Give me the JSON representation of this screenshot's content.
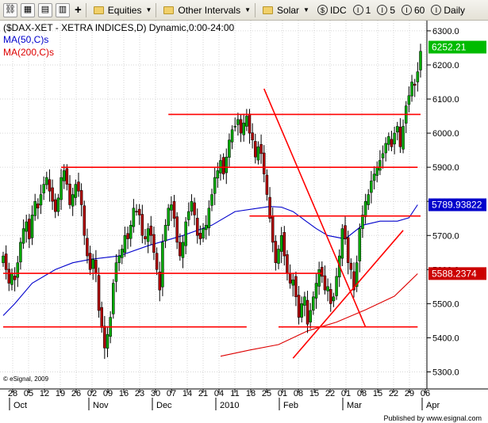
{
  "toolbar": {
    "menus": [
      "Equities",
      "Other Intervals",
      "Solar"
    ],
    "idc_label": "IDC",
    "interval_buttons": [
      {
        "icon": "I",
        "label": "1"
      },
      {
        "icon": "I",
        "label": "5"
      },
      {
        "icon": "I",
        "label": "60"
      }
    ],
    "daily_icon": "I",
    "daily_label": "Daily"
  },
  "chart_header": {
    "title": "($DAX-XET - XETRA INDICES,D) Dynamic,0:00-24:00",
    "ma50_label": "MA(50,C)s",
    "ma200_label": "MA(200,C)s"
  },
  "price_badges": {
    "last": "6252.21",
    "ma50": "5789.93822",
    "ma200": "5588.2374"
  },
  "watermark": "© eSignal, 2009",
  "footer": "Published by www.esignal.com",
  "colors": {
    "up_candle": "#00aa00",
    "down_candle": "#b00000",
    "ma50": "#0000cc",
    "ma200": "#dd0000",
    "trendlines": "#ff0000",
    "last_badge": "#00bb00",
    "ma50_badge": "#0000cc",
    "ma200_badge": "#cc0000"
  },
  "chart_data": {
    "type": "candlestick",
    "title": "($DAX-XET - XETRA INDICES,D) Dynamic,0:00-24:00",
    "y_axis_side": "right",
    "ylim": [
      5250,
      6330
    ],
    "y_ticks": [
      5300,
      5400,
      5500,
      5600,
      5700,
      5800,
      5900,
      6000,
      6100,
      6200,
      6300
    ],
    "x_ticks": [
      "28",
      "05",
      "12",
      "19",
      "26",
      "02",
      "09",
      "16",
      "23",
      "30",
      "07",
      "14",
      "21",
      "04",
      "11",
      "18",
      "25",
      "01",
      "08",
      "15",
      "22",
      "01",
      "08",
      "15",
      "22",
      "29",
      "06"
    ],
    "months": [
      "Oct",
      "Nov",
      "Dec",
      "2010",
      "Feb",
      "Mar",
      "Apr"
    ],
    "grid": true,
    "series": [
      {
        "name": "$DAX-XET",
        "kind": "close",
        "values": [
          5640,
          5600,
          5560,
          5590,
          5570,
          5620,
          5680,
          5720,
          5740,
          5690,
          5760,
          5800,
          5780,
          5820,
          5850,
          5870,
          5830,
          5800,
          5770,
          5810,
          5870,
          5890,
          5850,
          5790,
          5820,
          5850,
          5830,
          5790,
          5700,
          5640,
          5600,
          5630,
          5590,
          5480,
          5430,
          5370,
          5410,
          5460,
          5560,
          5620,
          5640,
          5660,
          5700,
          5690,
          5730,
          5780,
          5770,
          5760,
          5700,
          5690,
          5720,
          5700,
          5650,
          5600,
          5540,
          5680,
          5730,
          5780,
          5790,
          5750,
          5680,
          5640,
          5680,
          5740,
          5770,
          5800,
          5760,
          5700,
          5690,
          5720,
          5730,
          5780,
          5820,
          5870,
          5890,
          5920,
          5880,
          5930,
          5980,
          6010,
          6020,
          6040,
          6000,
          6030,
          6050,
          6000,
          5980,
          5930,
          5960,
          5940,
          5880,
          5820,
          5750,
          5680,
          5620,
          5660,
          5700,
          5640,
          5590,
          5560,
          5570,
          5520,
          5460,
          5500,
          5520,
          5440,
          5480,
          5520,
          5560,
          5600,
          5580,
          5540,
          5550,
          5500,
          5520,
          5580,
          5640,
          5720,
          5690,
          5620,
          5600,
          5540,
          5620,
          5720,
          5760,
          5800,
          5820,
          5860,
          5880,
          5900,
          5920,
          5940,
          5970,
          5990,
          5960,
          6000,
          6020,
          5960,
          6020,
          6080,
          6110,
          6150,
          6140,
          6180,
          6240
        ]
      },
      {
        "name": "MA(50,C)s",
        "points": [
          [
            0,
            5465
          ],
          [
            4,
            5500
          ],
          [
            10,
            5560
          ],
          [
            18,
            5600
          ],
          [
            24,
            5620
          ],
          [
            30,
            5630
          ],
          [
            40,
            5640
          ],
          [
            50,
            5670
          ],
          [
            62,
            5700
          ],
          [
            72,
            5730
          ],
          [
            80,
            5770
          ],
          [
            88,
            5780
          ],
          [
            92,
            5785
          ],
          [
            96,
            5783
          ],
          [
            100,
            5770
          ],
          [
            104,
            5745
          ],
          [
            108,
            5720
          ],
          [
            112,
            5700
          ],
          [
            118,
            5690
          ],
          [
            124,
            5730
          ],
          [
            130,
            5742
          ],
          [
            136,
            5742
          ],
          [
            140,
            5752
          ],
          [
            143,
            5790
          ]
        ]
      },
      {
        "name": "MA(200,C)s",
        "points": [
          [
            75,
            5346
          ],
          [
            85,
            5364
          ],
          [
            95,
            5380
          ],
          [
            105,
            5420
          ],
          [
            115,
            5446
          ],
          [
            125,
            5482
          ],
          [
            135,
            5522
          ],
          [
            143,
            5588
          ]
        ]
      }
    ],
    "trendlines": [
      {
        "points": [
          [
            0,
            5432
          ],
          [
            84,
            5432
          ]
        ]
      },
      {
        "points": [
          [
            0,
            5589
          ],
          [
            110,
            5589
          ]
        ]
      },
      {
        "points": [
          [
            95,
            5432
          ],
          [
            143,
            5432
          ]
        ]
      },
      {
        "points": [
          [
            20,
            5900
          ],
          [
            143,
            5900
          ]
        ]
      },
      {
        "points": [
          [
            85,
            5757
          ],
          [
            144,
            5757
          ]
        ]
      },
      {
        "points": [
          [
            57,
            6055
          ],
          [
            144,
            6055
          ]
        ]
      },
      {
        "points": [
          [
            90,
            6130
          ],
          [
            125,
            5432
          ]
        ]
      },
      {
        "points": [
          [
            100,
            5340
          ],
          [
            138,
            5715
          ]
        ]
      }
    ]
  }
}
